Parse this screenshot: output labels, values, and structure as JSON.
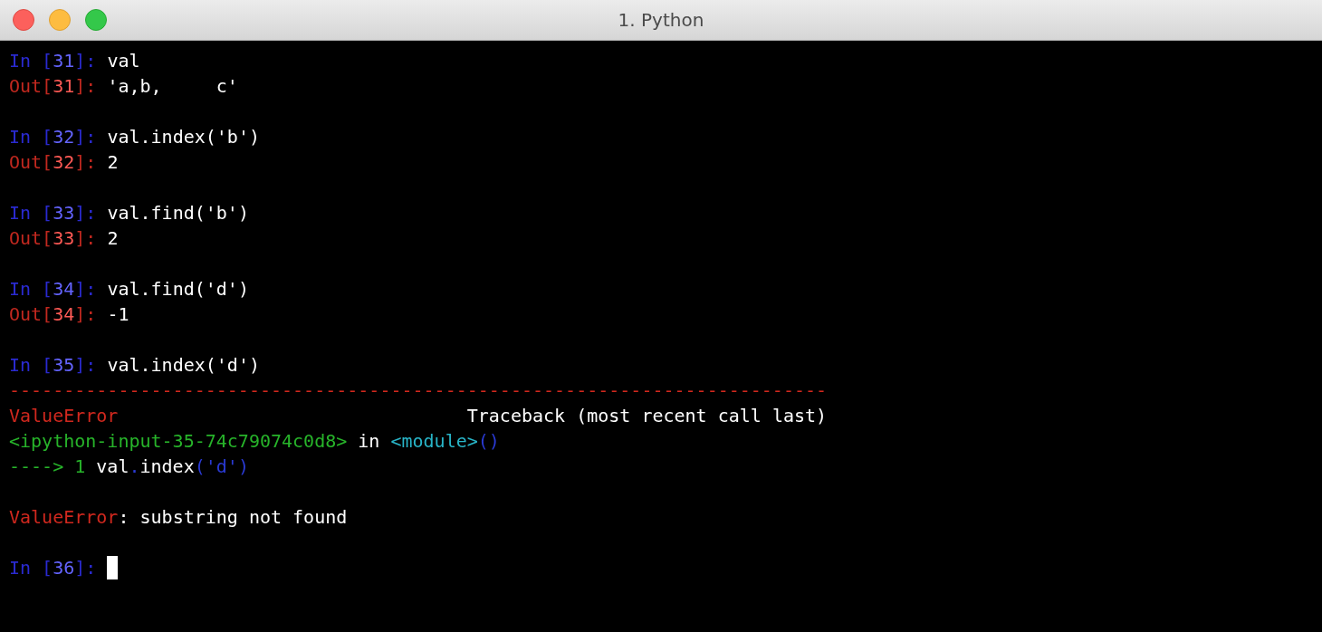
{
  "window": {
    "title": "1. Python"
  },
  "blocks": [
    [
      {
        "segments": [
          {
            "text": "In [",
            "kind": "in"
          },
          {
            "text": "31",
            "kind": "in_num"
          },
          {
            "text": "]: ",
            "kind": "in"
          },
          {
            "text": "val",
            "kind": "plain"
          }
        ]
      },
      {
        "segments": [
          {
            "text": "Out[",
            "kind": "out"
          },
          {
            "text": "31",
            "kind": "out_num"
          },
          {
            "text": "]: ",
            "kind": "out"
          },
          {
            "text": "'a,b,     c'",
            "kind": "plain"
          }
        ]
      }
    ],
    [
      {
        "segments": [
          {
            "text": "In [",
            "kind": "in"
          },
          {
            "text": "32",
            "kind": "in_num"
          },
          {
            "text": "]: ",
            "kind": "in"
          },
          {
            "text": "val.index('b')",
            "kind": "plain"
          }
        ]
      },
      {
        "segments": [
          {
            "text": "Out[",
            "kind": "out"
          },
          {
            "text": "32",
            "kind": "out_num"
          },
          {
            "text": "]: ",
            "kind": "out"
          },
          {
            "text": "2",
            "kind": "plain"
          }
        ]
      }
    ],
    [
      {
        "segments": [
          {
            "text": "In [",
            "kind": "in"
          },
          {
            "text": "33",
            "kind": "in_num"
          },
          {
            "text": "]: ",
            "kind": "in"
          },
          {
            "text": "val.find('b')",
            "kind": "plain"
          }
        ]
      },
      {
        "segments": [
          {
            "text": "Out[",
            "kind": "out"
          },
          {
            "text": "33",
            "kind": "out_num"
          },
          {
            "text": "]: ",
            "kind": "out"
          },
          {
            "text": "2",
            "kind": "plain"
          }
        ]
      }
    ],
    [
      {
        "segments": [
          {
            "text": "In [",
            "kind": "in"
          },
          {
            "text": "34",
            "kind": "in_num"
          },
          {
            "text": "]: ",
            "kind": "in"
          },
          {
            "text": "val.find('d')",
            "kind": "plain"
          }
        ]
      },
      {
        "segments": [
          {
            "text": "Out[",
            "kind": "out"
          },
          {
            "text": "34",
            "kind": "out_num"
          },
          {
            "text": "]: ",
            "kind": "out"
          },
          {
            "text": "-1",
            "kind": "plain"
          }
        ]
      }
    ],
    [
      {
        "segments": [
          {
            "text": "In [",
            "kind": "in"
          },
          {
            "text": "35",
            "kind": "in_num"
          },
          {
            "text": "]: ",
            "kind": "in"
          },
          {
            "text": "val.index('d')",
            "kind": "plain"
          }
        ]
      },
      {
        "segments": [
          {
            "text": "---------------------------------------------------------------------------",
            "kind": "error"
          }
        ]
      },
      {
        "segments": [
          {
            "text": "ValueError",
            "kind": "error"
          },
          {
            "text": "                                Traceback (most recent call last)",
            "kind": "plain"
          }
        ]
      },
      {
        "segments": [
          {
            "text": "<ipython-input-35-74c79074c0d8>",
            "kind": "green"
          },
          {
            "text": " in ",
            "kind": "plain"
          },
          {
            "text": "<module>",
            "kind": "cyan"
          },
          {
            "text": "()",
            "kind": "blue"
          }
        ]
      },
      {
        "segments": [
          {
            "text": "----> 1 ",
            "kind": "green"
          },
          {
            "text": "val",
            "kind": "plain"
          },
          {
            "text": ".",
            "kind": "blue"
          },
          {
            "text": "index",
            "kind": "plain"
          },
          {
            "text": "('d')",
            "kind": "blue"
          }
        ]
      }
    ],
    [
      {
        "segments": [
          {
            "text": "ValueError",
            "kind": "error"
          },
          {
            "text": ": substring not found",
            "kind": "plain"
          }
        ]
      }
    ],
    [
      {
        "segments": [
          {
            "text": "In [",
            "kind": "in"
          },
          {
            "text": "36",
            "kind": "in_num"
          },
          {
            "text": "]: ",
            "kind": "in"
          }
        ],
        "cursor": true
      }
    ]
  ]
}
